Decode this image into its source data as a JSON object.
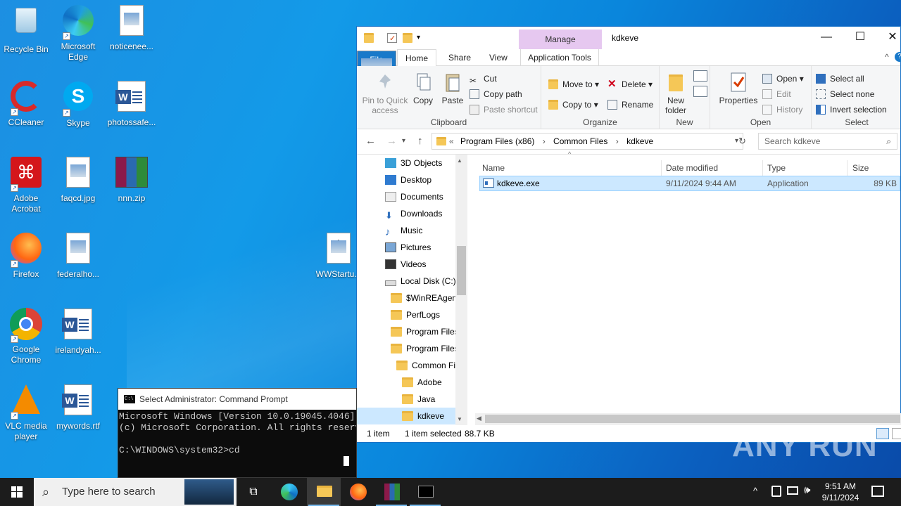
{
  "desktop": {
    "icons": [
      {
        "label": "Recycle Bin",
        "icon": "recycle-bin-icon"
      },
      {
        "label": "Microsoft Edge",
        "icon": "edge-icon"
      },
      {
        "label": "noticenee...",
        "icon": "image-file-icon"
      },
      {
        "label": "CCleaner",
        "icon": "ccleaner-icon"
      },
      {
        "label": "Skype",
        "icon": "skype-icon"
      },
      {
        "label": "photossafe...",
        "icon": "word-doc-icon"
      },
      {
        "label": "Adobe Acrobat",
        "icon": "acrobat-icon"
      },
      {
        "label": "faqcd.jpg",
        "icon": "image-file-icon"
      },
      {
        "label": "nnn.zip",
        "icon": "winrar-icon"
      },
      {
        "label": "Firefox",
        "icon": "firefox-icon"
      },
      {
        "label": "federalho...",
        "icon": "image-file-icon"
      },
      {
        "label": "WWStartu...",
        "icon": "settings-file-icon"
      },
      {
        "label": "Google Chrome",
        "icon": "chrome-icon"
      },
      {
        "label": "irelandyah...",
        "icon": "word-doc-icon"
      },
      {
        "label": "VLC media player",
        "icon": "vlc-icon"
      },
      {
        "label": "mywords.rtf",
        "icon": "word-doc-icon"
      }
    ]
  },
  "explorer": {
    "title": "kdkeve",
    "context_tab": "Manage",
    "tabs": [
      "File",
      "Home",
      "Share",
      "View",
      "Application Tools"
    ],
    "ribbon": {
      "clipboard": {
        "label": "Clipboard",
        "pin": "Pin to Quick access",
        "copy": "Copy",
        "paste": "Paste",
        "cut": "Cut",
        "copy_path": "Copy path",
        "paste_shortcut": "Paste shortcut"
      },
      "organize": {
        "label": "Organize",
        "move_to": "Move to",
        "copy_to": "Copy to",
        "delete": "Delete",
        "rename": "Rename"
      },
      "new": {
        "label": "New",
        "new_folder": "New folder"
      },
      "open": {
        "label": "Open",
        "properties": "Properties",
        "open": "Open",
        "edit": "Edit",
        "history": "History"
      },
      "select": {
        "label": "Select",
        "select_all": "Select all",
        "select_none": "Select none",
        "invert": "Invert selection"
      }
    },
    "address": {
      "prefix": "«",
      "crumbs": [
        "Program Files (x86)",
        "Common Files",
        "kdkeve"
      ],
      "search_placeholder": "Search kdkeve"
    },
    "nav_items": [
      {
        "label": "3D Objects",
        "indent": 0
      },
      {
        "label": "Desktop",
        "indent": 0
      },
      {
        "label": "Documents",
        "indent": 0
      },
      {
        "label": "Downloads",
        "indent": 0
      },
      {
        "label": "Music",
        "indent": 0
      },
      {
        "label": "Pictures",
        "indent": 0
      },
      {
        "label": "Videos",
        "indent": 0
      },
      {
        "label": "Local Disk (C:)",
        "indent": 0
      },
      {
        "label": "$WinREAgent",
        "indent": 1
      },
      {
        "label": "PerfLogs",
        "indent": 1
      },
      {
        "label": "Program Files",
        "indent": 1
      },
      {
        "label": "Program Files",
        "indent": 1
      },
      {
        "label": "Common Fi",
        "indent": 2
      },
      {
        "label": "Adobe",
        "indent": 3
      },
      {
        "label": "Java",
        "indent": 3
      },
      {
        "label": "kdkeve",
        "indent": 3
      }
    ],
    "columns": [
      "Name",
      "Date modified",
      "Type",
      "Size"
    ],
    "files": [
      {
        "name": "kdkeve.exe",
        "date": "9/11/2024 9:44 AM",
        "type": "Application",
        "size": "89 KB"
      }
    ],
    "status": {
      "count": "1 item",
      "selected": "1 item selected",
      "size": "88.7 KB"
    }
  },
  "cmd": {
    "title": "Select Administrator: Command Prompt",
    "lines": [
      "Microsoft Windows [Version 10.0.19045.4046]",
      "(c) Microsoft Corporation. All rights reserved.",
      "",
      "C:\\WINDOWS\\system32>cd"
    ]
  },
  "taskbar": {
    "search_placeholder": "Type here to search",
    "time": "9:51 AM",
    "date": "9/11/2024"
  },
  "watermark": "ANY RUN",
  "colors": {
    "accent": "#1979ca",
    "selection": "#cce8ff",
    "manage_tab": "#e6c8f0"
  }
}
